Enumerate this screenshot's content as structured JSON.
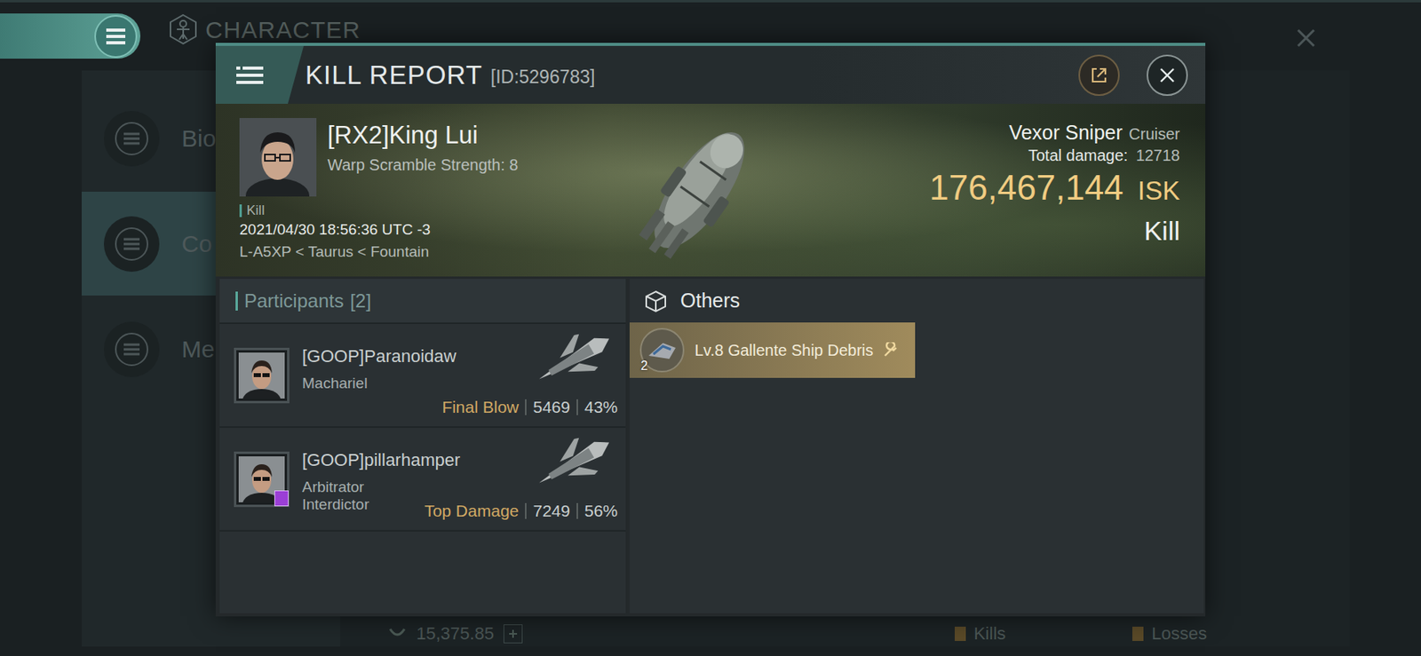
{
  "background": {
    "title": "CHARACTER",
    "sidebar": [
      {
        "label": "Bio",
        "selected": false
      },
      {
        "label": "Co",
        "selected": true
      },
      {
        "label": "Me",
        "selected": false
      }
    ],
    "footer": {
      "value": "15,375.85",
      "tabs": [
        "Kills",
        "Losses"
      ]
    }
  },
  "kill_report": {
    "title": "KILL REPORT",
    "id": "[ID:5296783]",
    "victim": {
      "name": "[RX2]King Lui",
      "detail": "Warp Scramble Strength: 8",
      "tag": "Kill",
      "time": "2021/04/30 18:56:36 UTC -3",
      "location": "L-A5XP < Taurus < Fountain"
    },
    "ship": {
      "name": "Vexor Sniper",
      "class": "Cruiser",
      "damage_label": "Total damage:",
      "damage": "12718",
      "value": "176,467,144",
      "currency": "ISK",
      "result": "Kill"
    },
    "participants": {
      "label": "Participants",
      "count": "[2]",
      "items": [
        {
          "name": "[GOOP]Paranoidaw",
          "ship": "Machariel",
          "role": "Final Blow",
          "damage": "5469",
          "share": "43%",
          "badge": false
        },
        {
          "name": "[GOOP]pillarhamper",
          "ship": "Arbitrator Interdictor",
          "role": "Top Damage",
          "damage": "7249",
          "share": "56%",
          "badge": true
        }
      ]
    },
    "others": {
      "label": "Others",
      "items": [
        {
          "name": "Lv.8 Gallente Ship Debris",
          "quantity": "2"
        }
      ]
    }
  }
}
